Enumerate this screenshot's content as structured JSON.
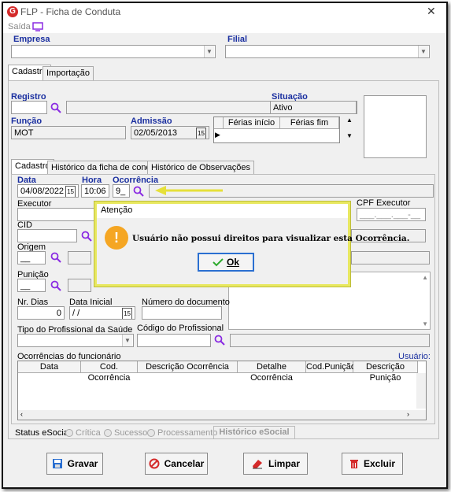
{
  "window": {
    "title": "FLP - Ficha de Conduta",
    "logo": "G",
    "close": "✕"
  },
  "menu": {
    "saida": "Saída"
  },
  "top": {
    "empresa_label": "Empresa",
    "filial_label": "Filial"
  },
  "outer_tabs": [
    "Cadastro",
    "Importação"
  ],
  "registro": {
    "label": "Registro",
    "value": ""
  },
  "situacao": {
    "label": "Situação",
    "value": "Ativo"
  },
  "funcao": {
    "label": "Função",
    "value": "MOT"
  },
  "admissao": {
    "label": "Admissão",
    "value": "02/05/2013",
    "cal": "15"
  },
  "ferias": {
    "col1": "Férias início",
    "col2": "Férias fim"
  },
  "inner_tabs": [
    "Cadastro",
    "Histórico da ficha de conduta",
    "Histórico de Observações"
  ],
  "data": {
    "label": "Data",
    "value": "04/08/2022",
    "cal": "15"
  },
  "hora": {
    "label": "Hora",
    "value": "10:06"
  },
  "ocorrencia": {
    "label": "Ocorrência",
    "value": "9_"
  },
  "executor": {
    "label": "Executor"
  },
  "cpf_executor": {
    "label": "CPF Executor",
    "value": "___.___.___-__"
  },
  "cid": {
    "label": "CID"
  },
  "origem": {
    "label": "Origem",
    "value": "__"
  },
  "punicao": {
    "label": "Punição",
    "value": "__"
  },
  "nr_dias": {
    "label": "Nr. Dias",
    "value": "0"
  },
  "data_inicial": {
    "label": "Data Inicial",
    "value": " / /",
    "cal": "15"
  },
  "num_documento": {
    "label": "Número do documento"
  },
  "tipo_profissional": {
    "label": "Tipo do Profissional da Saúde"
  },
  "codigo_profissional": {
    "label": "Código do Profissional"
  },
  "ocorrencias": {
    "label": "Ocorrências do funcionário",
    "usuario_label": "Usuário:",
    "columns": [
      "Data",
      "Cod. Ocorrência",
      "Descrição Ocorrência",
      "Detalhe Ocorrência",
      "Cod.Punição",
      "Descrição Punição"
    ]
  },
  "status": {
    "label": "Status eSocial:",
    "critica": "Crítica",
    "sucesso": "Sucesso",
    "processamento": "Processamento",
    "historico_btn": "Histórico eSocial"
  },
  "buttons": {
    "gravar": "Gravar",
    "cancelar": "Cancelar",
    "limpar": "Limpar",
    "excluir": "Excluir"
  },
  "dialog": {
    "title": "Atenção",
    "message": "Usuário não possui direitos para visualizar esta Ocorrência.",
    "ok": "Ok",
    "warning_glyph": "!"
  },
  "colors": {
    "accent_label": "#1a2fa0",
    "dialog_border": "#e8e860",
    "arrow": "#e6e03a",
    "warning": "#f5a623"
  }
}
